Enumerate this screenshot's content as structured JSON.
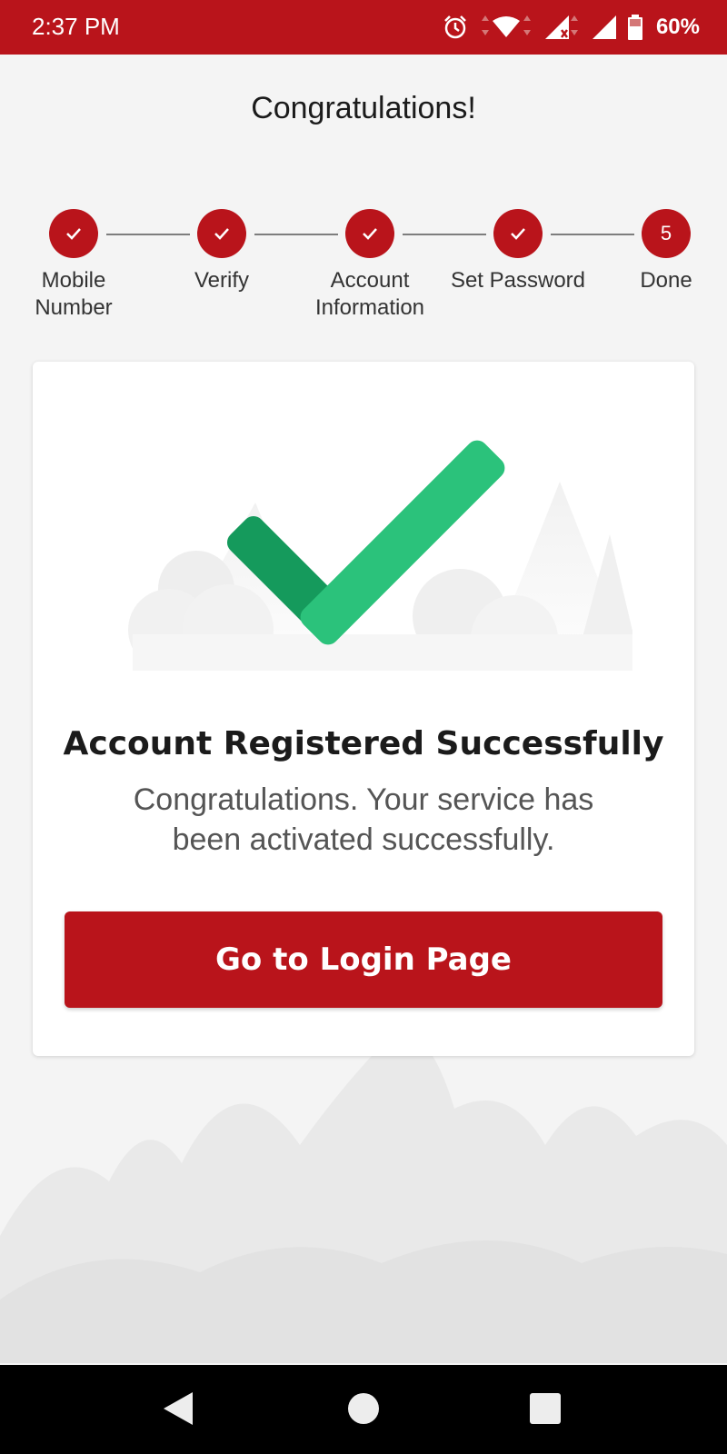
{
  "status_bar": {
    "time": "2:37 PM",
    "battery": "60%",
    "icons": [
      "alarm-icon",
      "wifi-icon",
      "signal-no-service-icon",
      "signal-icon",
      "battery-icon"
    ],
    "color": "#b9141b"
  },
  "page": {
    "title": "Congratulations!"
  },
  "stepper": {
    "steps": [
      {
        "label_line1": "Mobile",
        "label_line2": "Number",
        "marker": "check-icon"
      },
      {
        "label_line1": "Verify",
        "label_line2": "",
        "marker": "check-icon"
      },
      {
        "label_line1": "Account",
        "label_line2": "Information",
        "marker": "check-icon"
      },
      {
        "label_line1": "Set Password",
        "label_line2": "",
        "marker": "check-icon"
      },
      {
        "label_line1": "Done",
        "label_line2": "",
        "number": "5"
      }
    ],
    "accent": "#b9141b"
  },
  "card": {
    "title": "Account Registered Successfully",
    "message_line1": "Congratulations. Your service has",
    "message_line2": "been activated successfully.",
    "button_label": "Go to Login Page",
    "check_colors": [
      "#2bc27b",
      "#159a5c"
    ]
  },
  "nav_bar": {
    "icons": [
      "back-icon",
      "home-icon",
      "recents-icon"
    ]
  }
}
